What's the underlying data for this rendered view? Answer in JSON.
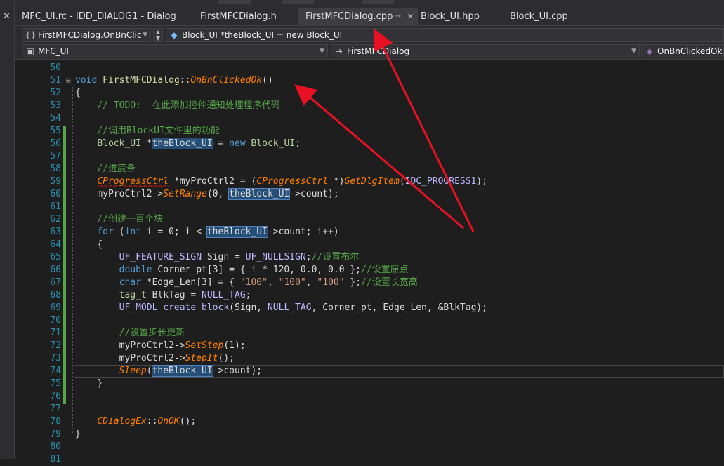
{
  "left_panel": {
    "close": "✕"
  },
  "tabs": [
    {
      "label": "MFC_UI.rc - IDD_DIALOG1 - Dialog",
      "active": false
    },
    {
      "label": "FirstMFCDialog.h",
      "active": false
    },
    {
      "label": "FirstMFCDialog.cpp",
      "active": true,
      "pin": "⊸",
      "close": "✕"
    },
    {
      "label": "Block_UI.hpp",
      "active": false
    },
    {
      "label": "Block_UI.cpp",
      "active": false
    }
  ],
  "nav1": {
    "member_combo": "FirstMFCDialog.OnBnClic",
    "scope_combo": "Block_UI *theBlock_UI = new Block_UI"
  },
  "nav2": {
    "project_combo": "MFC_UI",
    "class_combo": "FirstMFCDialog",
    "method_combo": "OnBnClickedOk()"
  },
  "code": {
    "lines": [
      {
        "n": "50",
        "text": ""
      },
      {
        "n": "51",
        "text": "void FirstMFCDialog::OnBnClickedOk()"
      },
      {
        "n": "52",
        "text": "{"
      },
      {
        "n": "53",
        "text": "    // TODO:  在此添加控件通知处理程序代码"
      },
      {
        "n": "54",
        "text": ""
      },
      {
        "n": "55",
        "text": "    //调用BlockUI文件里的功能"
      },
      {
        "n": "56",
        "text": "    Block_UI *theBlock_UI = new Block_UI;"
      },
      {
        "n": "57",
        "text": ""
      },
      {
        "n": "58",
        "text": "    //进度条"
      },
      {
        "n": "59",
        "text": "    CProgressCtrl *myProCtrl2 = (CProgressCtrl *)GetDlgItem(IDC_PROGRESS1);"
      },
      {
        "n": "60",
        "text": "    myProCtrl2->SetRange(0, theBlock_UI->count);"
      },
      {
        "n": "61",
        "text": ""
      },
      {
        "n": "62",
        "text": "    //创建一百个块"
      },
      {
        "n": "63",
        "text": "    for (int i = 0; i < theBlock_UI->count; i++)"
      },
      {
        "n": "64",
        "text": "    {"
      },
      {
        "n": "65",
        "text": "        UF_FEATURE_SIGN Sign = UF_NULLSIGN;//设置布尔"
      },
      {
        "n": "66",
        "text": "        double Corner_pt[3] = { i * 120, 0.0, 0.0 };//设置原点"
      },
      {
        "n": "67",
        "text": "        char *Edge_Len[3] = { \"100\", \"100\", \"100\" };//设置长宽高"
      },
      {
        "n": "68",
        "text": "        tag_t BlkTag = NULL_TAG;"
      },
      {
        "n": "69",
        "text": "        UF_MODL_create_block(Sign, NULL_TAG, Corner_pt, Edge_Len, &BlkTag);"
      },
      {
        "n": "70",
        "text": ""
      },
      {
        "n": "71",
        "text": "        //设置步长更新"
      },
      {
        "n": "72",
        "text": "        myProCtrl2->SetStep(1);"
      },
      {
        "n": "73",
        "text": "        myProCtrl2->StepIt();"
      },
      {
        "n": "74",
        "text": "        Sleep(theBlock_UI->count);"
      },
      {
        "n": "75",
        "text": "    }"
      },
      {
        "n": "76",
        "text": ""
      },
      {
        "n": "77",
        "text": ""
      },
      {
        "n": "78",
        "text": "    CDialogEx::OnOK();"
      },
      {
        "n": "79",
        "text": "}"
      },
      {
        "n": "80",
        "text": ""
      },
      {
        "n": "81",
        "text": ""
      }
    ]
  },
  "colors": {
    "background": "#1e1e1e",
    "line_number": "#2b91af",
    "keyword": "#569cd6",
    "comment": "#57a64a",
    "change_bar": "#57a64a",
    "annotation_arrow": "#e81123"
  }
}
